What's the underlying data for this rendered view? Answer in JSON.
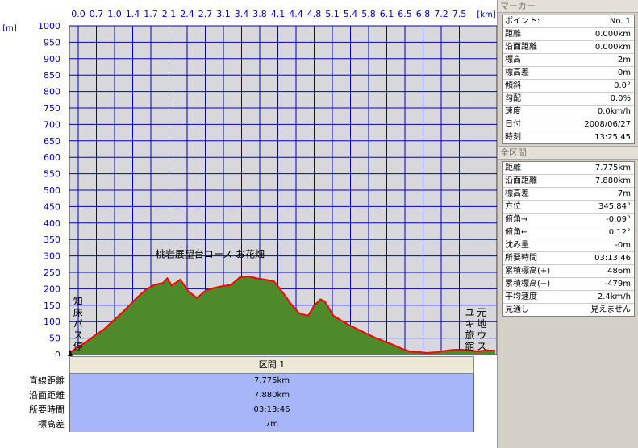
{
  "chart_data": {
    "type": "area",
    "title": "桃岩展望台コース お花畑",
    "xlabel": "[km]",
    "ylabel": "[m]",
    "xlim": [
      0,
      7.9
    ],
    "ylim": [
      0,
      1000
    ],
    "grid": true,
    "x_ticks": [
      "0.0",
      "0.7",
      "1.0",
      "1.4",
      "1.7",
      "2.1",
      "2.4",
      "2.7",
      "3.1",
      "3.4",
      "3.8",
      "4.1",
      "4.4",
      "4.8",
      "5.1",
      "5.4",
      "5.8",
      "6.1",
      "6.5",
      "6.8",
      "7.2",
      "7.5"
    ],
    "y_ticks": [
      0,
      50,
      100,
      150,
      200,
      250,
      300,
      350,
      400,
      450,
      500,
      550,
      600,
      650,
      700,
      750,
      800,
      850,
      900,
      950,
      1000
    ],
    "x": [
      0,
      0.16,
      0.31,
      0.47,
      0.63,
      0.79,
      0.94,
      1.1,
      1.26,
      1.42,
      1.57,
      1.73,
      1.81,
      1.89,
      2.05,
      2.2,
      2.36,
      2.52,
      2.68,
      2.83,
      2.99,
      3.15,
      3.31,
      3.46,
      3.62,
      3.78,
      3.93,
      4.09,
      4.25,
      4.41,
      4.52,
      4.64,
      4.72,
      4.88,
      5.04,
      5.19,
      5.35,
      5.51,
      5.67,
      5.82,
      5.98,
      6.14,
      6.3,
      6.45,
      6.61,
      6.77,
      6.93,
      7.08,
      7.24,
      7.4,
      7.55,
      7.71,
      7.87
    ],
    "values": [
      5,
      22,
      38,
      58,
      75,
      100,
      122,
      148,
      175,
      198,
      212,
      218,
      232,
      210,
      228,
      192,
      172,
      195,
      203,
      208,
      212,
      235,
      238,
      232,
      228,
      223,
      192,
      155,
      125,
      118,
      148,
      168,
      162,
      118,
      102,
      88,
      75,
      62,
      50,
      40,
      30,
      18,
      9,
      8,
      5,
      7,
      11,
      14,
      15,
      12,
      10,
      13,
      12
    ],
    "series": [
      {
        "values": [
          5,
          22,
          38,
          58,
          75,
          100,
          122,
          148,
          175,
          198,
          212,
          218,
          232,
          210,
          228,
          192,
          172,
          195,
          203,
          208,
          212,
          235,
          238,
          232,
          228,
          223,
          192,
          155,
          125,
          118,
          148,
          168,
          162,
          118,
          102,
          88,
          75,
          62,
          50,
          40,
          30,
          18,
          9,
          8,
          5,
          7,
          11,
          14,
          15,
          12,
          10,
          13,
          12
        ]
      }
    ],
    "annotations": [
      {
        "text": "桃岩展望台コース お花畑",
        "x": 2.6,
        "y": 310
      },
      {
        "text": "知床バス停",
        "x": 0.16,
        "y": 60,
        "vertical": true
      },
      {
        "text": "ユキ旅館",
        "x": 7.4,
        "y": 60,
        "vertical": true
      },
      {
        "text": "元地ウス",
        "x": 7.62,
        "y": 60,
        "vertical": true
      }
    ],
    "colors": {
      "fill": "#4f8a2a",
      "line": "#ff0000",
      "grid": "#0000c0",
      "plot_bg": "#d8d8dc"
    }
  },
  "section": {
    "header": "区間 1",
    "rows": [
      {
        "label": "直線距離",
        "value": "7.775km"
      },
      {
        "label": "沿面距離",
        "value": "7.880km"
      },
      {
        "label": "所要時間",
        "value": "03:13:46"
      },
      {
        "label": "標高差",
        "value": "7m"
      }
    ]
  },
  "marker": {
    "title": "マーカー",
    "rows": [
      {
        "label": "ポイント:",
        "value": "No. 1"
      },
      {
        "label": "距離",
        "value": "0.000km"
      },
      {
        "label": "沿面距離",
        "value": "0.000km"
      },
      {
        "label": "標高",
        "value": "2m"
      },
      {
        "label": "標高差",
        "value": "0m"
      },
      {
        "label": "傾斜",
        "value": "0.0°"
      },
      {
        "label": "勾配",
        "value": "0.0%"
      },
      {
        "label": "速度",
        "value": "0.0km/h"
      },
      {
        "label": "日付",
        "value": "2008/06/27"
      },
      {
        "label": "時刻",
        "value": "13:25:45"
      }
    ]
  },
  "total": {
    "title": "全区間",
    "rows": [
      {
        "label": "距離",
        "value": "7.775km"
      },
      {
        "label": "沿面距離",
        "value": "7.880km"
      },
      {
        "label": "標高差",
        "value": "7m"
      },
      {
        "label": "方位",
        "value": "345.84°"
      },
      {
        "label": "俯角→",
        "value": "-0.09°"
      },
      {
        "label": "俯角←",
        "value": "0.12°"
      },
      {
        "label": "沈み量",
        "value": "-0m"
      },
      {
        "label": "所要時間",
        "value": "03:13:46"
      },
      {
        "label": "累積標高(+)",
        "value": "486m"
      },
      {
        "label": "累積標高(−)",
        "value": "-479m"
      },
      {
        "label": "平均速度",
        "value": "2.4km/h"
      },
      {
        "label": "見通し",
        "value": "見えません"
      }
    ]
  }
}
